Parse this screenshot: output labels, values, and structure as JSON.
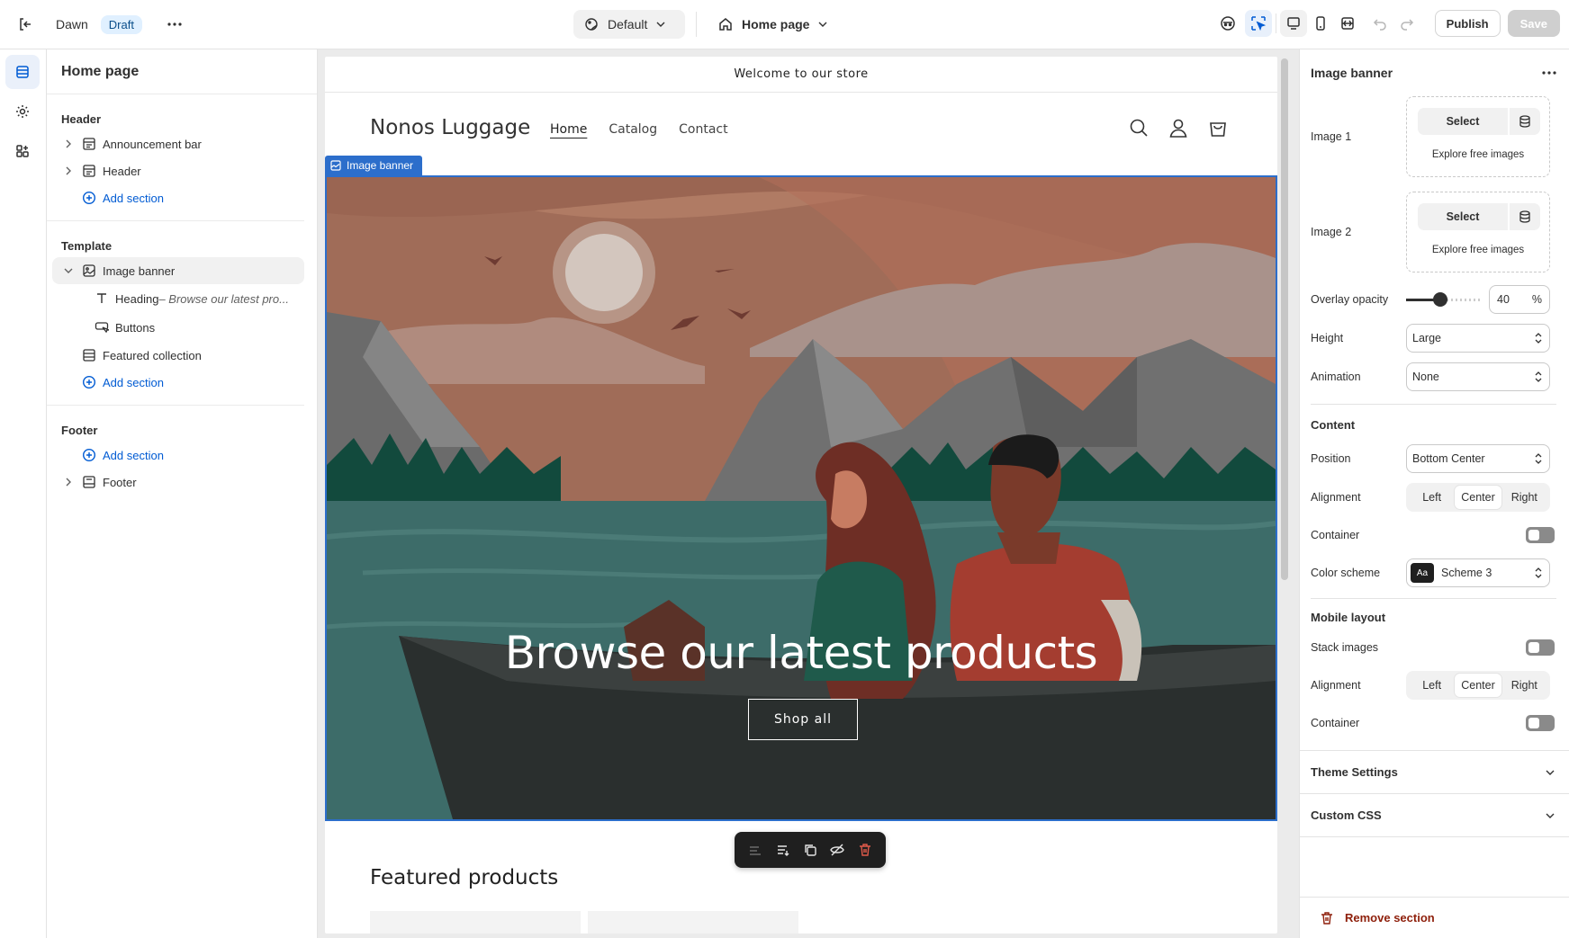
{
  "topbar": {
    "theme_name": "Dawn",
    "status_badge": "Draft",
    "preset": "Default",
    "page": "Home page",
    "publish_label": "Publish",
    "save_label": "Save"
  },
  "left_panel": {
    "title": "Home page",
    "header_group": {
      "title": "Header",
      "items": [
        "Announcement bar",
        "Header"
      ],
      "add_label": "Add section"
    },
    "template_group": {
      "title": "Template",
      "selected_section": "Image banner",
      "blocks": [
        {
          "label": "Heading",
          "detail": " – Browse our latest pro..."
        },
        {
          "label": "Buttons",
          "detail": ""
        }
      ],
      "other_section": "Featured collection",
      "add_label": "Add section"
    },
    "footer_group": {
      "title": "Footer",
      "add_label": "Add section",
      "items": [
        "Footer"
      ]
    }
  },
  "preview": {
    "announcement": "Welcome to our store",
    "store_name": "Nonos Luggage",
    "nav": [
      "Home",
      "Catalog",
      "Contact"
    ],
    "section_tag": "Image banner",
    "banner_heading": "Browse our latest products",
    "banner_button": "Shop all",
    "featured_title": "Featured products"
  },
  "right_panel": {
    "title": "Image banner",
    "image1_label": "Image 1",
    "image2_label": "Image 2",
    "select_label": "Select",
    "explore_label": "Explore free images",
    "overlay_label": "Overlay opacity",
    "overlay_value": "40",
    "overlay_unit": "%",
    "overlay_fraction": 0.4,
    "height_label": "Height",
    "height_value": "Large",
    "animation_label": "Animation",
    "animation_value": "None",
    "content_title": "Content",
    "position_label": "Position",
    "position_value": "Bottom Center",
    "alignment_label": "Alignment",
    "alignment_options": [
      "Left",
      "Center",
      "Right"
    ],
    "container_label": "Container",
    "color_scheme_label": "Color scheme",
    "color_scheme_chip": "Aa",
    "color_scheme_value": "Scheme 3",
    "mobile_title": "Mobile layout",
    "stack_images_label": "Stack images",
    "mobile_alignment_label": "Alignment",
    "mobile_container_label": "Container",
    "theme_settings_label": "Theme Settings",
    "custom_css_label": "Custom CSS",
    "remove_label": "Remove section"
  },
  "colors": {
    "accent": "#2c6ecb",
    "link": "#005bd3",
    "danger": "#8e1f0b"
  }
}
